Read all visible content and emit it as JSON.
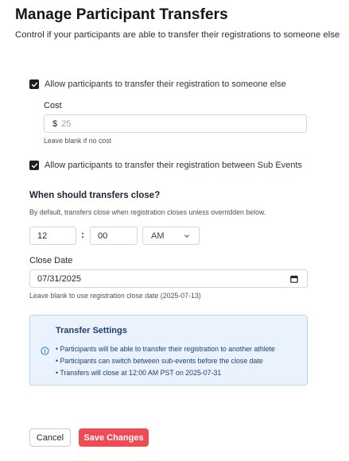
{
  "page": {
    "title": "Manage Participant Transfers",
    "subtitle": "Control if your participants are able to transfer their registrations to someone else"
  },
  "transfer_option": {
    "checked": true,
    "label": "Allow participants to transfer their registration to someone else"
  },
  "cost": {
    "label": "Cost",
    "prefix": "$",
    "value": "",
    "placeholder": "25",
    "help": "Leave blank if no cost"
  },
  "sub_event_option": {
    "checked": true,
    "label": "Allow participants to transfer their registration between Sub Events"
  },
  "close": {
    "heading": "When should transfers close?",
    "help": "By default, transfers close when registration closes unless overridden below.",
    "hour": "12",
    "separator": ":",
    "minute": "00",
    "period": "AM"
  },
  "close_date": {
    "label": "Close Date",
    "value": "07/31/2025",
    "help": "Leave blank to use registration close date (2025-07-13)"
  },
  "info": {
    "icon": "info-circle-icon",
    "title": "Transfer Settings",
    "items": [
      "• Participants will be able to transfer their registration to another athlete",
      "• Participants can switch between sub-events before the close date",
      "• Transfers will close at 12:00 AM PST on 2025-07-31"
    ]
  },
  "actions": {
    "cancel_label": "Cancel",
    "save_label": "Save Changes"
  },
  "colors": {
    "primary": "#f04a55",
    "info_bg": "#eaf3fd",
    "info_border": "#b8d4f2",
    "info_text": "#1d3f72",
    "checkbox": "#1f1f1f"
  }
}
